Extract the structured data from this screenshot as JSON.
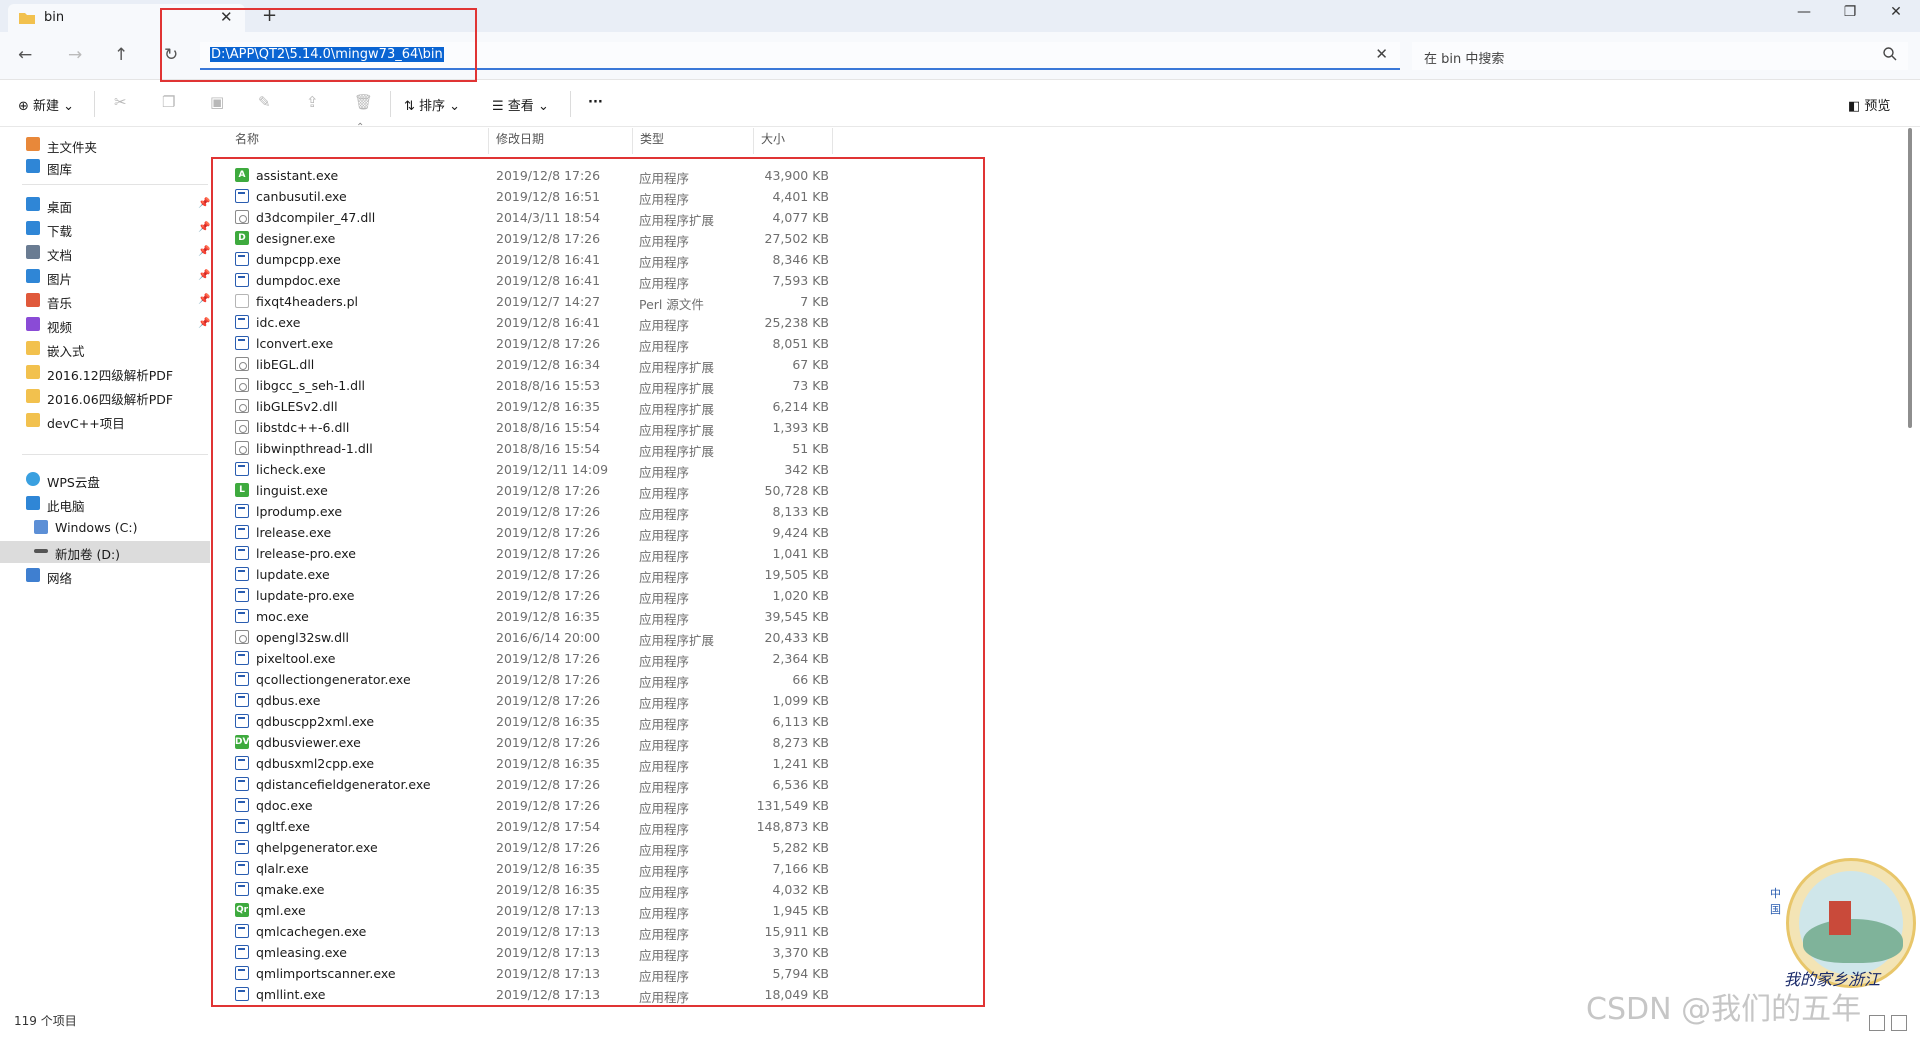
{
  "tab": {
    "title": "bin",
    "close": "✕",
    "new_tab": "+"
  },
  "window": {
    "minimize": "—",
    "restore": "❐",
    "close": "✕"
  },
  "nav": {
    "back": "←",
    "forward": "→",
    "up": "↑",
    "refresh": "↻"
  },
  "address": {
    "path": "D:\\APP\\QT2\\5.14.0\\mingw73_64\\bin",
    "clear": "✕"
  },
  "search": {
    "placeholder": "在 bin 中搜索",
    "icon": "🔍"
  },
  "toolbar": {
    "new_label": "新建",
    "sort_label": "排序",
    "view_label": "查看",
    "more_label": "···",
    "preview_label": "预览"
  },
  "sidebar": {
    "home": "主文件夹",
    "gallery": "图库",
    "pinned": [
      {
        "label": "桌面",
        "icon": "desktop-icon",
        "color": "#2f86d6"
      },
      {
        "label": "下载",
        "icon": "download-icon",
        "color": "#2f86d6"
      },
      {
        "label": "文档",
        "icon": "document-icon",
        "color": "#6a7c92"
      },
      {
        "label": "图片",
        "icon": "picture-icon",
        "color": "#2f86d6"
      },
      {
        "label": "音乐",
        "icon": "music-icon",
        "color": "#e0593b"
      },
      {
        "label": "视频",
        "icon": "video-icon",
        "color": "#8a4bd6"
      },
      {
        "label": "嵌入式",
        "icon": "folder-icon",
        "color": "#f2c14e"
      },
      {
        "label": "2016.12四级解析PDF",
        "icon": "folder-icon",
        "color": "#f2c14e"
      },
      {
        "label": "2016.06四级解析PDF",
        "icon": "folder-icon",
        "color": "#f2c14e"
      },
      {
        "label": "devC++项目",
        "icon": "folder-icon",
        "color": "#f2c14e"
      }
    ],
    "wps_cloud": "WPS云盘",
    "this_pc": "此电脑",
    "drive_c": "Windows (C:)",
    "drive_d": "新加卷 (D:)",
    "network": "网络"
  },
  "columns": {
    "name": "名称",
    "date": "修改日期",
    "type": "类型",
    "size": "大小"
  },
  "files": [
    {
      "name": "assistant.exe",
      "date": "2019/12/8 17:26",
      "type": "应用程序",
      "size": "43,900 KB",
      "icon": "A"
    },
    {
      "name": "canbusutil.exe",
      "date": "2019/12/8 16:51",
      "type": "应用程序",
      "size": "4,401 KB",
      "icon": "exe"
    },
    {
      "name": "d3dcompiler_47.dll",
      "date": "2014/3/11 18:54",
      "type": "应用程序扩展",
      "size": "4,077 KB",
      "icon": "dll"
    },
    {
      "name": "designer.exe",
      "date": "2019/12/8 17:26",
      "type": "应用程序",
      "size": "27,502 KB",
      "icon": "D"
    },
    {
      "name": "dumpcpp.exe",
      "date": "2019/12/8 16:41",
      "type": "应用程序",
      "size": "8,346 KB",
      "icon": "exe"
    },
    {
      "name": "dumpdoc.exe",
      "date": "2019/12/8 16:41",
      "type": "应用程序",
      "size": "7,593 KB",
      "icon": "exe"
    },
    {
      "name": "fixqt4headers.pl",
      "date": "2019/12/7 14:27",
      "type": "Perl 源文件",
      "size": "7 KB",
      "icon": "pl"
    },
    {
      "name": "idc.exe",
      "date": "2019/12/8 16:41",
      "type": "应用程序",
      "size": "25,238 KB",
      "icon": "exe"
    },
    {
      "name": "lconvert.exe",
      "date": "2019/12/8 17:26",
      "type": "应用程序",
      "size": "8,051 KB",
      "icon": "exe"
    },
    {
      "name": "libEGL.dll",
      "date": "2019/12/8 16:34",
      "type": "应用程序扩展",
      "size": "67 KB",
      "icon": "dll"
    },
    {
      "name": "libgcc_s_seh-1.dll",
      "date": "2018/8/16 15:53",
      "type": "应用程序扩展",
      "size": "73 KB",
      "icon": "dll"
    },
    {
      "name": "libGLESv2.dll",
      "date": "2019/12/8 16:35",
      "type": "应用程序扩展",
      "size": "6,214 KB",
      "icon": "dll"
    },
    {
      "name": "libstdc++-6.dll",
      "date": "2018/8/16 15:54",
      "type": "应用程序扩展",
      "size": "1,393 KB",
      "icon": "dll"
    },
    {
      "name": "libwinpthread-1.dll",
      "date": "2018/8/16 15:54",
      "type": "应用程序扩展",
      "size": "51 KB",
      "icon": "dll"
    },
    {
      "name": "licheck.exe",
      "date": "2019/12/11 14:09",
      "type": "应用程序",
      "size": "342 KB",
      "icon": "exe"
    },
    {
      "name": "linguist.exe",
      "date": "2019/12/8 17:26",
      "type": "应用程序",
      "size": "50,728 KB",
      "icon": "L"
    },
    {
      "name": "lprodump.exe",
      "date": "2019/12/8 17:26",
      "type": "应用程序",
      "size": "8,133 KB",
      "icon": "exe"
    },
    {
      "name": "lrelease.exe",
      "date": "2019/12/8 17:26",
      "type": "应用程序",
      "size": "9,424 KB",
      "icon": "exe"
    },
    {
      "name": "lrelease-pro.exe",
      "date": "2019/12/8 17:26",
      "type": "应用程序",
      "size": "1,041 KB",
      "icon": "exe"
    },
    {
      "name": "lupdate.exe",
      "date": "2019/12/8 17:26",
      "type": "应用程序",
      "size": "19,505 KB",
      "icon": "exe"
    },
    {
      "name": "lupdate-pro.exe",
      "date": "2019/12/8 17:26",
      "type": "应用程序",
      "size": "1,020 KB",
      "icon": "exe"
    },
    {
      "name": "moc.exe",
      "date": "2019/12/8 16:35",
      "type": "应用程序",
      "size": "39,545 KB",
      "icon": "exe"
    },
    {
      "name": "opengl32sw.dll",
      "date": "2016/6/14 20:00",
      "type": "应用程序扩展",
      "size": "20,433 KB",
      "icon": "dll"
    },
    {
      "name": "pixeltool.exe",
      "date": "2019/12/8 17:26",
      "type": "应用程序",
      "size": "2,364 KB",
      "icon": "exe"
    },
    {
      "name": "qcollectiongenerator.exe",
      "date": "2019/12/8 17:26",
      "type": "应用程序",
      "size": "66 KB",
      "icon": "exe"
    },
    {
      "name": "qdbus.exe",
      "date": "2019/12/8 17:26",
      "type": "应用程序",
      "size": "1,099 KB",
      "icon": "exe"
    },
    {
      "name": "qdbuscpp2xml.exe",
      "date": "2019/12/8 16:35",
      "type": "应用程序",
      "size": "6,113 KB",
      "icon": "exe"
    },
    {
      "name": "qdbusviewer.exe",
      "date": "2019/12/8 17:26",
      "type": "应用程序",
      "size": "8,273 KB",
      "icon": "DV"
    },
    {
      "name": "qdbusxml2cpp.exe",
      "date": "2019/12/8 16:35",
      "type": "应用程序",
      "size": "1,241 KB",
      "icon": "exe"
    },
    {
      "name": "qdistancefieldgenerator.exe",
      "date": "2019/12/8 17:26",
      "type": "应用程序",
      "size": "6,536 KB",
      "icon": "exe"
    },
    {
      "name": "qdoc.exe",
      "date": "2019/12/8 17:26",
      "type": "应用程序",
      "size": "131,549 KB",
      "icon": "exe"
    },
    {
      "name": "qgltf.exe",
      "date": "2019/12/8 17:54",
      "type": "应用程序",
      "size": "148,873 KB",
      "icon": "exe"
    },
    {
      "name": "qhelpgenerator.exe",
      "date": "2019/12/8 17:26",
      "type": "应用程序",
      "size": "5,282 KB",
      "icon": "exe"
    },
    {
      "name": "qlalr.exe",
      "date": "2019/12/8 16:35",
      "type": "应用程序",
      "size": "7,166 KB",
      "icon": "exe"
    },
    {
      "name": "qmake.exe",
      "date": "2019/12/8 16:35",
      "type": "应用程序",
      "size": "4,032 KB",
      "icon": "exe"
    },
    {
      "name": "qml.exe",
      "date": "2019/12/8 17:13",
      "type": "应用程序",
      "size": "1,945 KB",
      "icon": "Qr"
    },
    {
      "name": "qmlcachegen.exe",
      "date": "2019/12/8 17:13",
      "type": "应用程序",
      "size": "15,911 KB",
      "icon": "exe"
    },
    {
      "name": "qmleasing.exe",
      "date": "2019/12/8 17:13",
      "type": "应用程序",
      "size": "3,370 KB",
      "icon": "exe"
    },
    {
      "name": "qmlimportscanner.exe",
      "date": "2019/12/8 17:13",
      "type": "应用程序",
      "size": "5,794 KB",
      "icon": "exe"
    },
    {
      "name": "qmllint.exe",
      "date": "2019/12/8 17:13",
      "type": "应用程序",
      "size": "18,049 KB",
      "icon": "exe"
    }
  ],
  "status": {
    "item_count": "119 个项目"
  },
  "watermark": "CSDN @我们的五年",
  "badge": {
    "caption": "我的家乡浙江",
    "side_text": "中国"
  },
  "colors": {
    "accent": "#0a64d2",
    "annotation": "#e03434",
    "exe_icon": "#2a5db0",
    "qt_green": "#3eaa3e"
  }
}
